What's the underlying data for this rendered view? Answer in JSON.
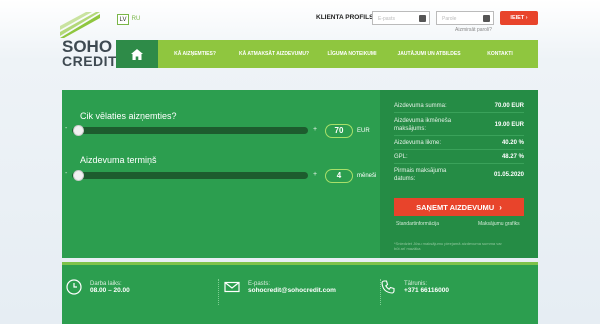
{
  "brand": {
    "line1": "SOHO",
    "line2": "CREDIT"
  },
  "languages": [
    "LV",
    "RU"
  ],
  "header": {
    "client_label": "KLIENTA PROFILS",
    "user_placeholder": "E-pasts",
    "pass_placeholder": "Parole",
    "forgot": "Aizmirsāt paroli?",
    "login": "IEIET"
  },
  "nav": [
    "KĀ AIZŅEMTIES?",
    "KĀ ATMAKSĀT AIZDEVUMU?",
    "LĪGUMA NOTEIKUMI",
    "JAUTĀJUMI UN ATBILDES",
    "KONTAKTI"
  ],
  "calculator": {
    "amount_question": "Cik vēlaties aizņemties?",
    "amount_value": "70",
    "amount_unit": "EUR",
    "term_question": "Aizdevuma termiņš",
    "term_value": "4",
    "term_unit": "mēneši",
    "minus": "-",
    "plus": "+"
  },
  "summary": [
    {
      "label": "Aizdevuma summa:",
      "value": "70.00 EUR"
    },
    {
      "label": "Aizdevuma ikmēneša maksājums:",
      "value": "19.00 EUR"
    },
    {
      "label": "Aizdevuma likme:",
      "value": "40.20 %"
    },
    {
      "label": "GPL:",
      "value": "48.27 %"
    },
    {
      "label": "Pirmais maksājuma datums:",
      "value": "01.05.2020"
    }
  ],
  "apply_button": "SAŅEMT AIZDEVUMU",
  "links": {
    "standard": "Standartinformācija",
    "schedule": "Maksājumu grafiks"
  },
  "note": "*Sniedziet Jūsu maksājumu pieejamā aizdevuma summa var būt arī mazāka",
  "footer": {
    "hours_label": "Darba laiks:",
    "hours_value": "08.00 – 20.00",
    "email_label": "E-pasts:",
    "email_value": "sohocredit@sohocredit.com",
    "phone_label": "Tālrunis:",
    "phone_value": "+371 66116000"
  },
  "colors": {
    "green": "#2c9e4f",
    "lime": "#8fc63f",
    "red": "#e8442b"
  }
}
